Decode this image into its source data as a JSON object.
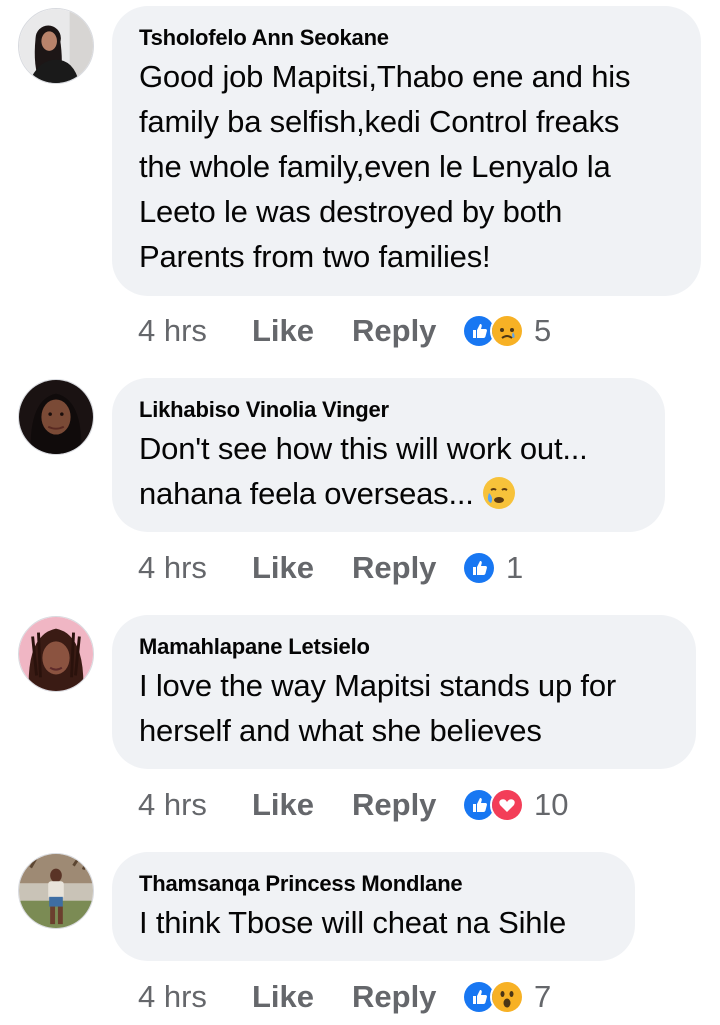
{
  "colors": {
    "bubble": "#f0f2f5",
    "meta_text": "#65676b",
    "like_blue": "#1877f2",
    "love_red": "#f33e58",
    "emoji_yellow": "#f7b125"
  },
  "comments": [
    {
      "author": "Tsholofelo Ann Seokane",
      "text": "Good job Mapitsi,Thabo ene and his\nfamily ba selfish,kedi Control freaks\nthe whole family,even le Lenyalo la\nLeeto le was destroyed by both\nParents from two families!",
      "time": "4 hrs",
      "like": "Like",
      "reply": "Reply",
      "reactions": [
        "like-icon",
        "sad-icon"
      ],
      "count": "5"
    },
    {
      "author": "Likhabiso Vinolia Vinger",
      "text": "Don't see how this will work out...\nnahana feela overseas...",
      "inline_emoji": "crying-face-emoji",
      "time": "4 hrs",
      "like": "Like",
      "reply": "Reply",
      "reactions": [
        "like-icon"
      ],
      "count": "1"
    },
    {
      "author": "Mamahlapane Letsielo",
      "text": "I love the way Mapitsi stands up for\nherself and what she believes",
      "time": "4 hrs",
      "like": "Like",
      "reply": "Reply",
      "reactions": [
        "like-icon",
        "love-icon"
      ],
      "count": "10"
    },
    {
      "author": "Thamsanqa Princess Mondlane",
      "text": "I think Tbose will cheat na Sihle",
      "time": "4 hrs",
      "like": "Like",
      "reply": "Reply",
      "reactions": [
        "like-icon",
        "wow-icon"
      ],
      "count": "7"
    }
  ]
}
